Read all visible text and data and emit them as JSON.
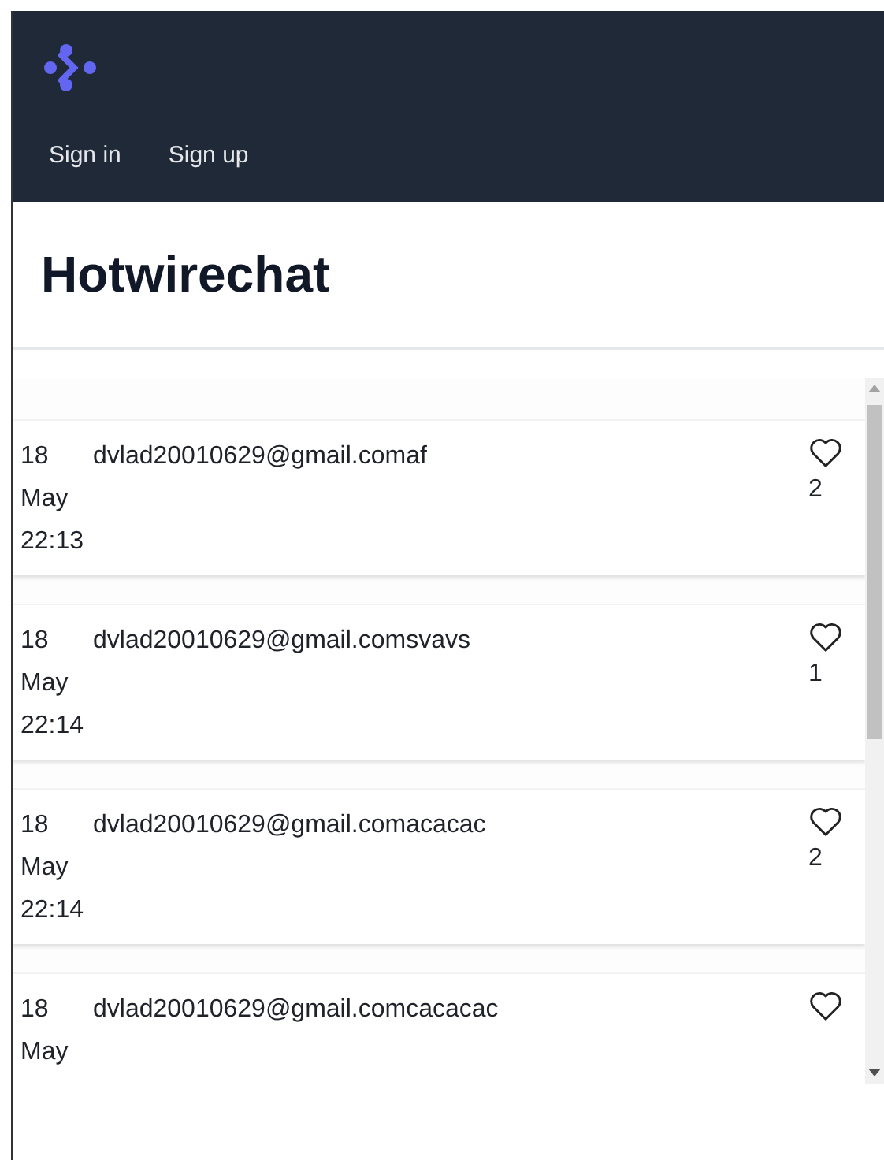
{
  "nav": [
    {
      "label": "Sign in"
    },
    {
      "label": "Sign up"
    }
  ],
  "title": "Hotwirechat",
  "messages": [
    {
      "day": "18",
      "month": "May",
      "time": "22:13",
      "text": "dvlad20010629@gmail.comaf",
      "likes": "2"
    },
    {
      "day": "18",
      "month": "May",
      "time": "22:14",
      "text": "dvlad20010629@gmail.comsvavs",
      "likes": "1"
    },
    {
      "day": "18",
      "month": "May",
      "time": "22:14",
      "text": "dvlad20010629@gmail.comacacac",
      "likes": "2"
    },
    {
      "day": "18",
      "month": "May",
      "text": "dvlad20010629@gmail.comcacacac"
    }
  ]
}
